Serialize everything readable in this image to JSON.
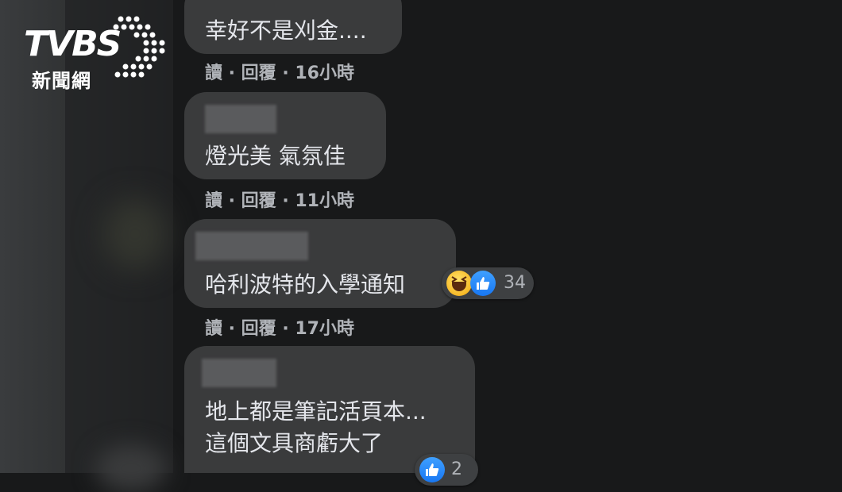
{
  "logo": {
    "brand": "TVBS",
    "subtitle": "新聞網"
  },
  "comments": [
    {
      "text": "幸好不是刈金....",
      "meta": "讀 · 回覆 · 16小時"
    },
    {
      "text": "燈光美 氣氛佳",
      "meta": "讀 · 回覆 · 11小時"
    },
    {
      "text": "哈利波特的入學通知",
      "meta": "讀 · 回覆 · 17小時",
      "reactions": {
        "icons": [
          "haha-icon",
          "like-icon"
        ],
        "count": "34"
      }
    },
    {
      "text_line1": "地上都是筆記活頁本...",
      "text_line2": "這個文具商虧大了",
      "reactions": {
        "icons": [
          "like-icon"
        ],
        "count": "2"
      }
    }
  ],
  "colors": {
    "bubble": "#3a3b3c",
    "background": "#18191a",
    "meta": "#b0b3b8",
    "like": "#1877f2",
    "haha": "#f7b928"
  }
}
